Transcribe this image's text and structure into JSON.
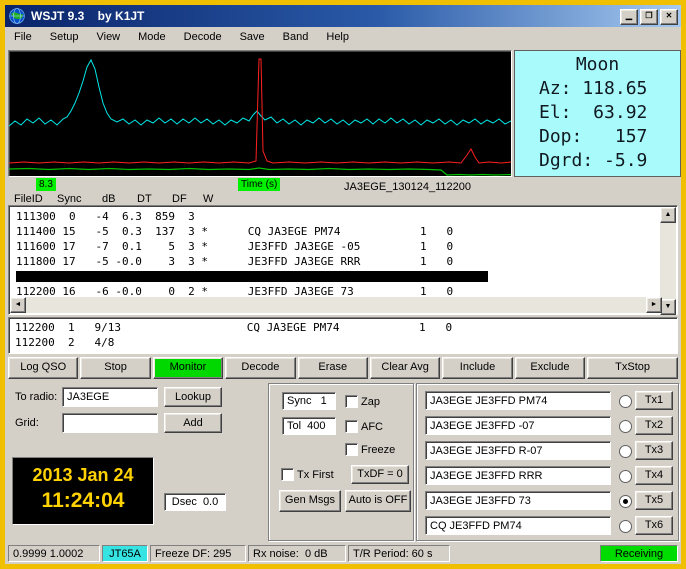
{
  "window": {
    "title": "WSJT 9.3    by K1JT"
  },
  "icons": {
    "minimize": "▁",
    "maximize": "❐",
    "close": "✕",
    "arrow_up": "▲",
    "arrow_down": "▼",
    "arrow_left": "◄",
    "arrow_right": "►"
  },
  "menu": {
    "items": [
      "File",
      "Setup",
      "View",
      "Mode",
      "Decode",
      "Save",
      "Band",
      "Help"
    ]
  },
  "moon": {
    "title": "Moon",
    "lines": [
      "Az: 118.65",
      "El:  63.92",
      "Dop:   157",
      "Dgrd: -5.9"
    ]
  },
  "spectrum": {
    "start_label": "8.3",
    "time_label": "Time (s)",
    "file_label": "JA3EGE_130124_112200"
  },
  "decode": {
    "headers": [
      "FileID",
      "Sync",
      "dB",
      "DT",
      "DF",
      "W"
    ],
    "main_lines": [
      "111300  0   -4  6.3  859  3",
      "111400 15   -5  0.3  137  3 *      CQ JA3EGE PM74            1   0",
      "111600 17   -7  0.1    5  3 *      JE3FFD JA3EGE -05         1   0",
      "111800 17   -5 -0.0    3  3 *      JE3FFD JA3EGE RRR         1   0",
      "112200 16   -6 -0.0    0  2 *      JE3FFD JA3EGE 73          1   0"
    ],
    "avg_lines": [
      "112200  1   9/13                   CQ JA3EGE PM74            1   0",
      "112200  2   4/8"
    ]
  },
  "toolbar": {
    "buttons": [
      "Log QSO",
      "Stop",
      "Monitor",
      "Decode",
      "Erase",
      "Clear Avg",
      "Include",
      "Exclude",
      "TxStop"
    ]
  },
  "station": {
    "to_radio_label": "To radio:",
    "to_radio_value": "JA3EGE",
    "lookup": "Lookup",
    "grid_label": "Grid:",
    "grid_value": "",
    "add": "Add",
    "date": "2013 Jan 24",
    "time": "11:24:04",
    "dsec": "Dsec  0.0"
  },
  "controls": {
    "sync": "Sync   1",
    "zap": "Zap",
    "tol": "Tol  400",
    "afc": "AFC",
    "freeze": "Freeze",
    "tx_first": "Tx First",
    "txdf": "TxDF = 0",
    "gen_msgs": "Gen Msgs",
    "auto": "Auto is OFF"
  },
  "tx": {
    "rows": [
      {
        "message": "JA3EGE JE3FFD PM74",
        "button": "Tx1",
        "selected": false
      },
      {
        "message": "JA3EGE JE3FFD -07",
        "button": "Tx2",
        "selected": false
      },
      {
        "message": "JA3EGE JE3FFD R-07",
        "button": "Tx3",
        "selected": false
      },
      {
        "message": "JA3EGE JE3FFD RRR",
        "button": "Tx4",
        "selected": false
      },
      {
        "message": "JA3EGE JE3FFD 73",
        "button": "Tx5",
        "selected": true
      },
      {
        "message": "CQ JE3FFD PM74",
        "button": "Tx6",
        "selected": false
      }
    ]
  },
  "status": {
    "calibration": "0.9999 1.0002",
    "mode": "JT65A",
    "freeze_df": "Freeze DF: 295",
    "rx_noise": "Rx noise:  0 dB",
    "tr_period": "T/R Period: 60 s",
    "state": "Receiving"
  },
  "colors": {
    "border_gold": "#F0C000",
    "title_blue": "#0A246A",
    "moon_bg": "#A9FBFB",
    "label_green": "#00F000",
    "monitor_green": "#00D800",
    "receiving_green": "#00DC00",
    "mode_cyan": "#35E3E3",
    "clock_text": "#FFD200"
  }
}
